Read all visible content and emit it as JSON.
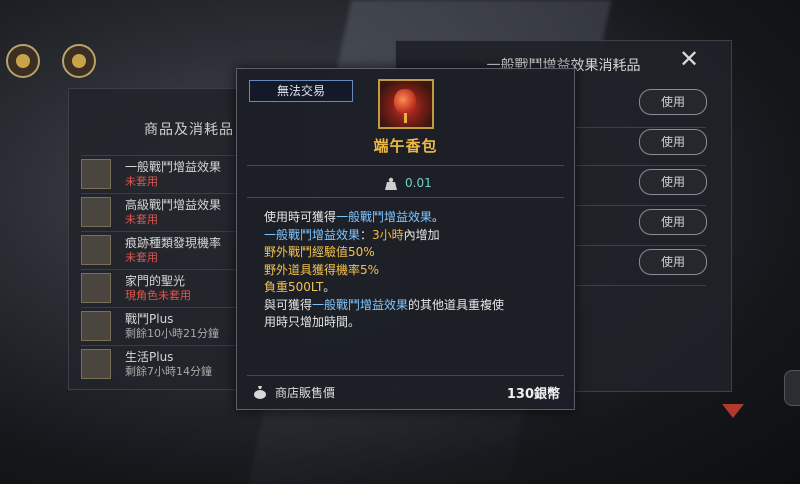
{
  "tooltip": {
    "trade_badge": "無法交易",
    "item_name": "端午香包",
    "weight": "0.01",
    "desc_lines": [
      [
        {
          "t": "使用時可獲得",
          "c": "w"
        },
        {
          "t": "一般戰鬥增益效果",
          "c": "b"
        },
        {
          "t": "。",
          "c": "w"
        }
      ],
      [
        {
          "t": "一般戰鬥增益效果",
          "c": "b"
        },
        {
          "t": "：",
          "c": "w"
        },
        {
          "t": "3小時",
          "c": "o"
        },
        {
          "t": "內增加",
          "c": "w"
        }
      ],
      [
        {
          "t": "野外戰鬥經驗值50%",
          "c": "y"
        }
      ],
      [
        {
          "t": "野外道具獲得機率5%",
          "c": "y"
        }
      ],
      [
        {
          "t": "負重500LT",
          "c": "y"
        },
        {
          "t": "。",
          "c": "w"
        }
      ],
      [
        {
          "t": "與可獲得",
          "c": "w"
        },
        {
          "t": "一般戰鬥增益效果",
          "c": "b"
        },
        {
          "t": "的其他道具重複使",
          "c": "w"
        }
      ],
      [
        {
          "t": "用時只增加時間。",
          "c": "w"
        }
      ]
    ],
    "sale_label": "商店販售價",
    "sale_price": "130銀幣"
  },
  "left_panel": {
    "title": "商品及消耗品",
    "items": [
      {
        "name": "一般戰鬥增益效果",
        "status": "未套用",
        "tone": "red"
      },
      {
        "name": "高級戰鬥增益效果",
        "status": "未套用",
        "tone": "red"
      },
      {
        "name": "痕跡種類發現機率",
        "status": "未套用",
        "tone": "red"
      },
      {
        "name": "家門的聖光",
        "status": "現角色未套用",
        "tone": "red"
      },
      {
        "name": "戰鬥Plus",
        "status": "剩餘10小時21分鐘",
        "tone": "gray"
      },
      {
        "name": "生活Plus",
        "status": "剩餘7小時14分鐘",
        "tone": "gray"
      }
    ]
  },
  "right_panel": {
    "title": "一般戰鬥增益效果消耗品",
    "use_label": "使用",
    "use_buttons": 5
  },
  "colors": {
    "item_name": "#f0b944",
    "highlight_blue": "#7fc6ff",
    "highlight_yellow": "#f2c24e",
    "weight": "#72d0c8",
    "status_red": "#e0554d"
  }
}
